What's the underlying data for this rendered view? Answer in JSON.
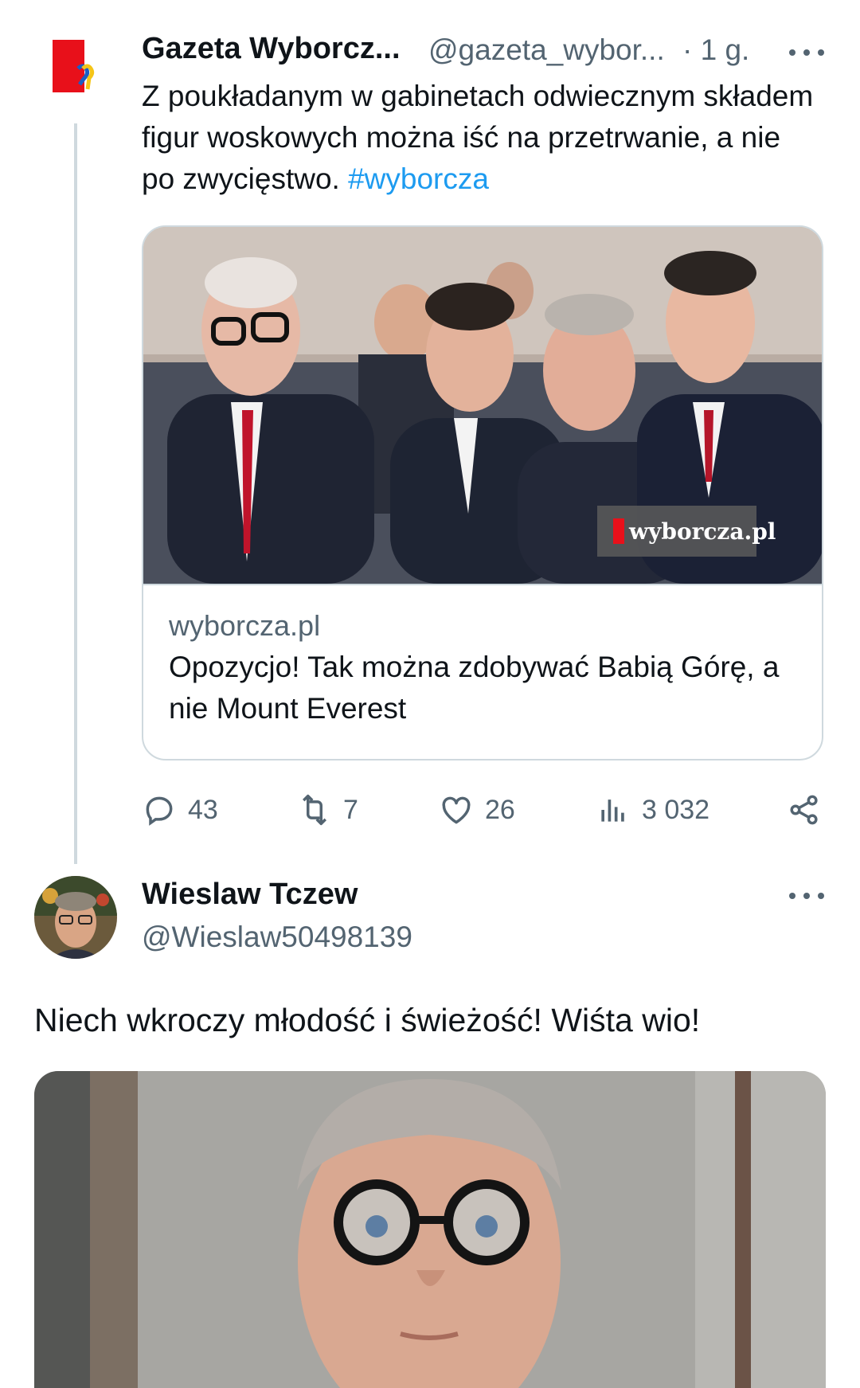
{
  "tweet1": {
    "author_name": "Gazeta Wyborcz...",
    "handle": "@gazeta_wybor...",
    "time": "· 1 g.",
    "text": "Z poukładanym w gabinetach odwiecznym składem figur woskowych można iść na przetrwanie, a nie po zwycięstwo.",
    "hashtag": "#wyborcza",
    "card": {
      "watermark": "wyborcza.pl",
      "domain": "wyborcza.pl",
      "title": "Opozycjo! Tak można zdobywać Babią Górę, a nie Mount Everest"
    },
    "actions": {
      "replies": "43",
      "retweets": "7",
      "likes": "26",
      "views": "3 032"
    },
    "icons": [
      "reply-icon",
      "retweet-icon",
      "like-icon",
      "views-icon",
      "share-icon",
      "more-icon"
    ],
    "colors": {
      "link": "#1d9bf0",
      "secondary": "#536471",
      "border": "#cfd9de"
    }
  },
  "tweet2": {
    "author_name": "Wieslaw Tczew",
    "handle": "@Wieslaw50498139",
    "text": "Niech wkroczy młodość i świeżość! Wiśta wio!"
  }
}
